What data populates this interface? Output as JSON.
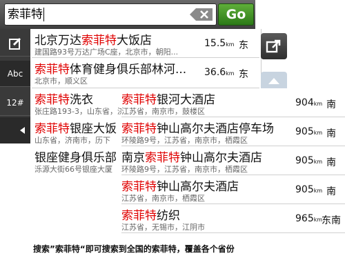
{
  "search": {
    "value": "索菲特",
    "go_label": "Go"
  },
  "sidebar": {
    "items": [
      {
        "label": "",
        "icon": "edit-icon"
      },
      {
        "label": "Abc"
      },
      {
        "label": "12#"
      },
      {
        "label": "",
        "icon": "back-arrow-icon"
      }
    ]
  },
  "back_results": [
    {
      "name_pre": "北京万达",
      "name_hl": "索菲特",
      "name_post": "大饭店",
      "address": "建国路93号万达广场C座，北京市，朝阳...",
      "distance": "15.5",
      "unit": "km",
      "direction": "东"
    },
    {
      "name_pre": "",
      "name_hl": "索菲特",
      "name_post": "体育健身俱乐部林河...",
      "address": "北京市，顺义区",
      "distance": "36.6",
      "unit": "km",
      "direction": "东"
    }
  ],
  "left_results": [
    {
      "name_pre": "",
      "name_hl": "索菲特",
      "name_post": "洗衣",
      "address": "张庄路193-3，山东省，济南市"
    },
    {
      "name_pre": "",
      "name_hl": "索菲特",
      "name_post": "银座大饭",
      "address": "山东省，济南市，历下"
    },
    {
      "name_pre": "银座健身俱乐部",
      "name_hl": "",
      "name_post": "",
      "address": "泺源大街66号银座大厦"
    }
  ],
  "front_results": [
    {
      "name_pre": "",
      "name_hl": "索菲特",
      "name_post": "银河大酒店",
      "address": "江苏省，南京市，鼓楼区",
      "distance": "904",
      "unit": "km",
      "direction": "南"
    },
    {
      "name_pre": "",
      "name_hl": "索菲特",
      "name_post": "钟山高尔夫酒店停车场",
      "address": "环陵路9号，江苏省，南京市，栖霞区",
      "distance": "905",
      "unit": "km",
      "direction": "南"
    },
    {
      "name_pre": "南京",
      "name_hl": "索菲特",
      "name_post": "钟山高尔夫酒店",
      "address": "环陵路9号，江苏省，南京市，栖霞区",
      "distance": "905",
      "unit": "km",
      "direction": "南"
    },
    {
      "name_pre": "",
      "name_hl": "索菲特",
      "name_post": "钟山高尔夫酒店",
      "address": "江苏省，南京市，栖霞区",
      "distance": "905",
      "unit": "km",
      "direction": "南"
    },
    {
      "name_pre": "",
      "name_hl": "索菲特",
      "name_post": "纺织",
      "address": "江苏省，无锡市，江阴市",
      "distance": "965",
      "unit": "km",
      "direction": "东南"
    }
  ],
  "footer": {
    "text": "搜索”索菲特“即可搜索到全国的索菲特，覆盖各个省份"
  },
  "colors": {
    "highlight": "#e00000",
    "go_green": "#3d8f22"
  }
}
